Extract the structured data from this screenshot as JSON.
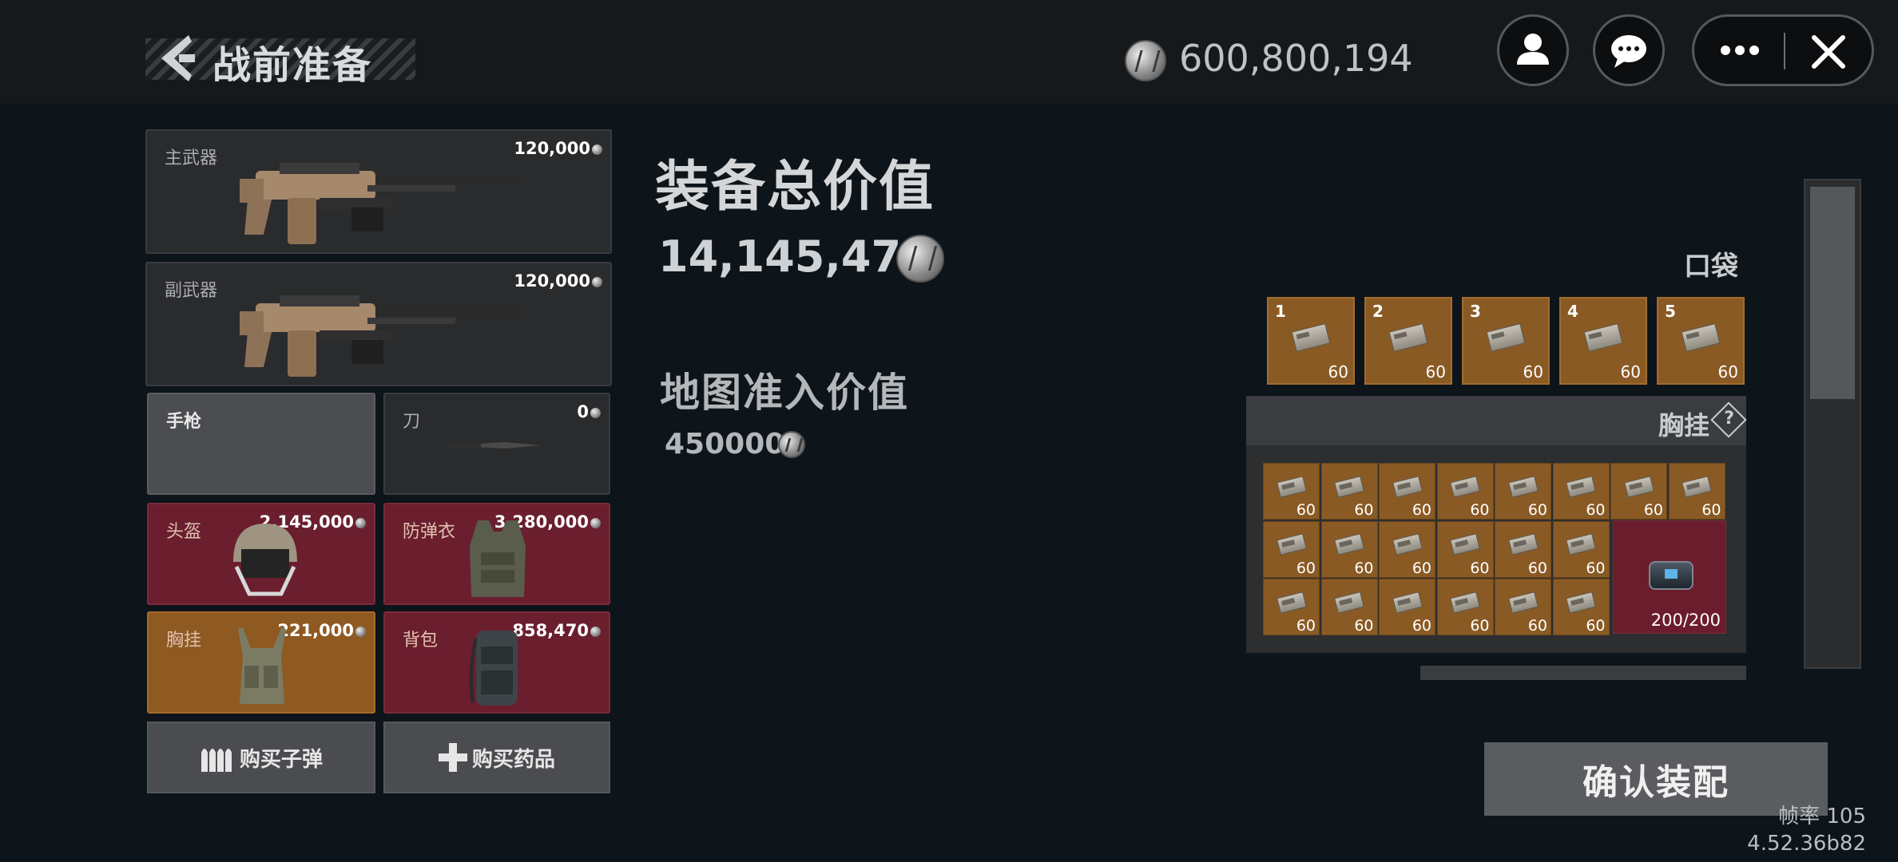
{
  "header": {
    "title": "战前准备",
    "currency": "600,800,194"
  },
  "loadout": {
    "primary": {
      "label": "主武器",
      "price": "120,000"
    },
    "secondary": {
      "label": "副武器",
      "price": "120,000"
    },
    "pistol": {
      "label": "手枪"
    },
    "knife": {
      "label": "刀",
      "price": "0"
    },
    "helmet": {
      "label": "头盔",
      "price": "2,145,000"
    },
    "armor": {
      "label": "防弹衣",
      "price": "3,280,000"
    },
    "chest_rig": {
      "label": "胸挂",
      "price": "221,000"
    },
    "backpack": {
      "label": "背包",
      "price": "858,470"
    },
    "buy_ammo": "购买子弹",
    "buy_meds": "购买药品"
  },
  "summary": {
    "total_label": "装备总价值",
    "total_value": "14,145,470",
    "map_label": "地图准入价值",
    "map_value": "450000"
  },
  "pocket": {
    "title": "口袋",
    "slots": [
      {
        "num": "1",
        "count": "60"
      },
      {
        "num": "2",
        "count": "60"
      },
      {
        "num": "3",
        "count": "60"
      },
      {
        "num": "4",
        "count": "60"
      },
      {
        "num": "5",
        "count": "60"
      }
    ]
  },
  "chest": {
    "title": "胸挂",
    "cell_count": "60",
    "kit_count": "200/200"
  },
  "confirm_label": "确认装配",
  "fps": "帧率 105",
  "version": "4.52.36b82",
  "colors": {
    "red_slot": "#6a1e2e",
    "orange_slot": "#8e5a22",
    "bg": "#0d141a"
  }
}
